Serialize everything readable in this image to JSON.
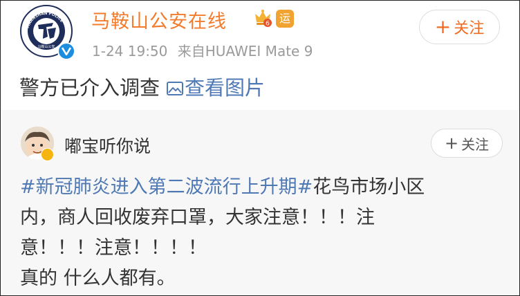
{
  "post": {
    "author_name": "马鞍山公安在线",
    "avatar_text": "MAANSHAN POLICE",
    "avatar_subtext": "马鞍山公安",
    "badge_text": "运",
    "time": "1-24 19:50",
    "source": "来自HUAWEI Mate 9",
    "follow_label": "关注",
    "follow_plus": "+",
    "text": "警方已介入调查",
    "view_images_label": "查看图片"
  },
  "repost": {
    "author_name": "嘟宝听你说",
    "follow_label": "关注",
    "follow_plus": "+",
    "hashtag": "#新冠肺炎进入第二波流行上升期#",
    "line1_rest": "花鸟市场小区",
    "line2": "内，商人回收废弃口罩，大家注意！！！注",
    "line3": "意！！！注意！！！！",
    "line4": "真的 什么人都有。"
  },
  "colors": {
    "author_orange": "#f27b2c",
    "follow_orange": "#f06b21",
    "link_blue": "#4f79b5",
    "verified_blue": "#1d8de0",
    "repost_bg": "#f7f7f7",
    "meta_gray": "#9a9a9a"
  },
  "icons": {
    "verified": "verified-v-icon",
    "crown": "member-crown-icon",
    "image": "image-icon",
    "medal": "medal-icon"
  }
}
